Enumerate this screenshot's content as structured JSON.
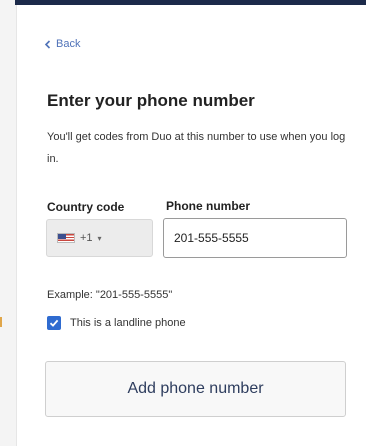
{
  "back_link": {
    "label": "Back"
  },
  "header": {
    "title": "Enter your phone number",
    "subtitle": "You'll get codes from Duo at this number to use when you log in."
  },
  "form": {
    "country_code": {
      "label": "Country code",
      "flag_icon": "us-flag-icon",
      "selected_value": "+1"
    },
    "phone_number": {
      "label": "Phone number",
      "value": "201-555-5555"
    },
    "example_text": "Example: \"201-555-5555\"",
    "landline_checkbox": {
      "label": "This is a landline phone",
      "checked": true
    },
    "submit_label": "Add phone number"
  },
  "colors": {
    "accent": "#2f6bd0",
    "top_bar": "#1c2a4a",
    "link": "#4f72b8"
  }
}
